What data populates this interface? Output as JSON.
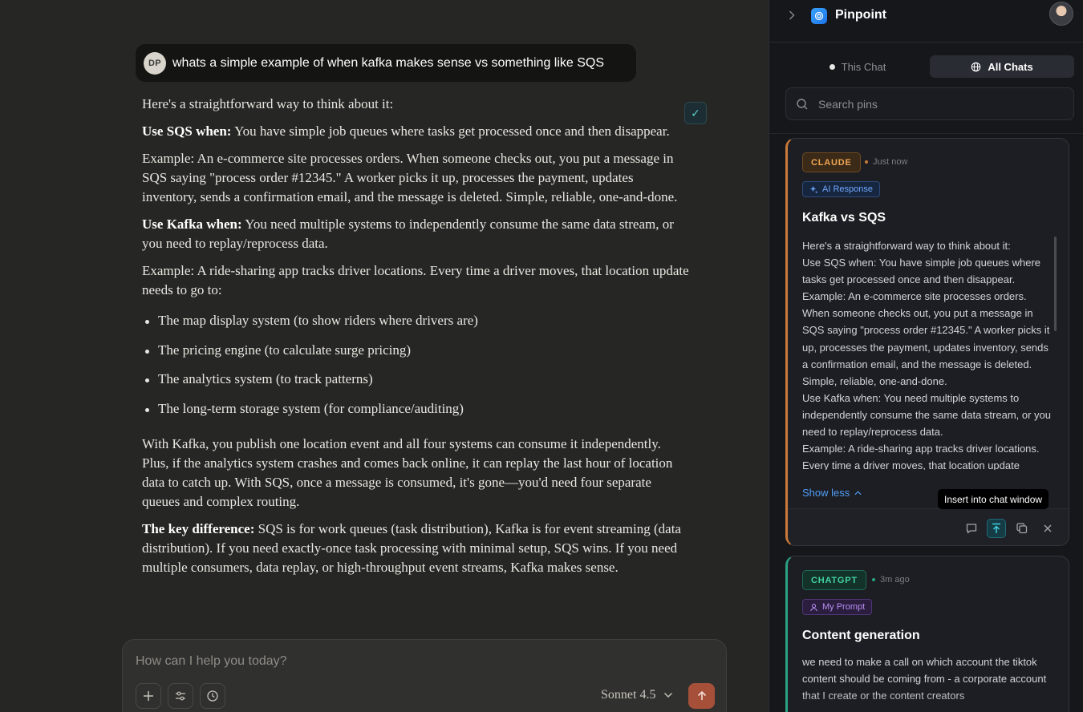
{
  "chat": {
    "user_initials": "DP",
    "user_message": "whats a simple example of when kafka makes sense vs something like SQS",
    "check_glyph": "✓",
    "response": {
      "intro": "Here's a straightforward way to think about it:",
      "sqs_label": "Use SQS when:",
      "sqs_text": " You have simple job queues where tasks get processed once and then disappear.",
      "sqs_example": "Example: An e-commerce site processes orders. When someone checks out, you put a message in SQS saying \"process order #12345.\" A worker picks it up, processes the payment, updates inventory, sends a confirmation email, and the message is deleted. Simple, reliable, one-and-done.",
      "kafka_label": "Use Kafka when:",
      "kafka_text": " You need multiple systems to independently consume the same data stream, or you need to replay/reprocess data.",
      "kafka_example": "Example: A ride-sharing app tracks driver locations. Every time a driver moves, that location update needs to go to:",
      "bullets": [
        "The map display system (to show riders where drivers are)",
        "The pricing engine (to calculate surge pricing)",
        "The analytics system (to track patterns)",
        "The long-term storage system (for compliance/auditing)"
      ],
      "kafka_summary": "With Kafka, you publish one location event and all four systems can consume it independently. Plus, if the analytics system crashes and comes back online, it can replay the last hour of location data to catch up. With SQS, once a message is consumed, it's gone—you'd need four separate queues and complex routing.",
      "diff_label": "The key difference:",
      "diff_text": " SQS is for work queues (task distribution), Kafka is for event streaming (data distribution). If you need exactly-once task processing with minimal setup, SQS wins. If you need multiple consumers, data replay, or high-throughput event streams, Kafka makes sense."
    },
    "composer": {
      "placeholder": "How can I help you today?",
      "model": "Sonnet 4.5"
    }
  },
  "panel": {
    "app_name": "Pinpoint",
    "tabs": [
      "This Chat",
      "All Chats"
    ],
    "active_tab": "All Chats",
    "search_placeholder": "Search pins",
    "cards": [
      {
        "source": "CLAUDE",
        "time": "Just now",
        "type": "AI Response",
        "title": "Kafka vs SQS",
        "body": [
          "Here's a straightforward way to think about it:",
          "Use SQS when: You have simple job queues where tasks get processed once and then disappear.",
          "Example: An e-commerce site processes orders. When someone checks out, you put a message in SQS saying \"process order #12345.\" A worker picks it up, processes the payment, updates inventory, sends a confirmation email, and the message is deleted. Simple, reliable, one-and-done.",
          "Use Kafka when: You need multiple systems to independently consume the same data stream, or you need to replay/reprocess data.",
          "Example: A ride-sharing app tracks driver locations. Every time a driver moves, that location update"
        ],
        "toggle": "Show less",
        "tooltip": "Insert into chat window"
      },
      {
        "source": "CHATGPT",
        "time": "3m ago",
        "type": "My Prompt",
        "title": "Content generation",
        "body": "we need to make a call on which account the tiktok content should be coming from - a corporate account that I create or the content creators"
      }
    ]
  },
  "colors": {
    "claude_accent": "#f0a555",
    "chatgpt_accent": "#43d3a1",
    "link": "#4f9cf5",
    "send": "#a6503a"
  }
}
